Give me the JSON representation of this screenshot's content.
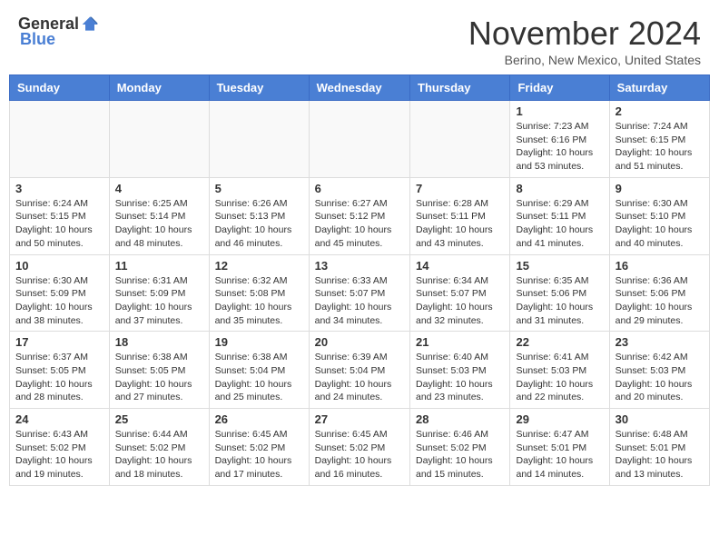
{
  "header": {
    "logo_general": "General",
    "logo_blue": "Blue",
    "month_title": "November 2024",
    "location": "Berino, New Mexico, United States"
  },
  "days_of_week": [
    "Sunday",
    "Monday",
    "Tuesday",
    "Wednesday",
    "Thursday",
    "Friday",
    "Saturday"
  ],
  "weeks": [
    [
      {
        "day": "",
        "info": ""
      },
      {
        "day": "",
        "info": ""
      },
      {
        "day": "",
        "info": ""
      },
      {
        "day": "",
        "info": ""
      },
      {
        "day": "",
        "info": ""
      },
      {
        "day": "1",
        "info": "Sunrise: 7:23 AM\nSunset: 6:16 PM\nDaylight: 10 hours and 53 minutes."
      },
      {
        "day": "2",
        "info": "Sunrise: 7:24 AM\nSunset: 6:15 PM\nDaylight: 10 hours and 51 minutes."
      }
    ],
    [
      {
        "day": "3",
        "info": "Sunrise: 6:24 AM\nSunset: 5:15 PM\nDaylight: 10 hours and 50 minutes."
      },
      {
        "day": "4",
        "info": "Sunrise: 6:25 AM\nSunset: 5:14 PM\nDaylight: 10 hours and 48 minutes."
      },
      {
        "day": "5",
        "info": "Sunrise: 6:26 AM\nSunset: 5:13 PM\nDaylight: 10 hours and 46 minutes."
      },
      {
        "day": "6",
        "info": "Sunrise: 6:27 AM\nSunset: 5:12 PM\nDaylight: 10 hours and 45 minutes."
      },
      {
        "day": "7",
        "info": "Sunrise: 6:28 AM\nSunset: 5:11 PM\nDaylight: 10 hours and 43 minutes."
      },
      {
        "day": "8",
        "info": "Sunrise: 6:29 AM\nSunset: 5:11 PM\nDaylight: 10 hours and 41 minutes."
      },
      {
        "day": "9",
        "info": "Sunrise: 6:30 AM\nSunset: 5:10 PM\nDaylight: 10 hours and 40 minutes."
      }
    ],
    [
      {
        "day": "10",
        "info": "Sunrise: 6:30 AM\nSunset: 5:09 PM\nDaylight: 10 hours and 38 minutes."
      },
      {
        "day": "11",
        "info": "Sunrise: 6:31 AM\nSunset: 5:09 PM\nDaylight: 10 hours and 37 minutes."
      },
      {
        "day": "12",
        "info": "Sunrise: 6:32 AM\nSunset: 5:08 PM\nDaylight: 10 hours and 35 minutes."
      },
      {
        "day": "13",
        "info": "Sunrise: 6:33 AM\nSunset: 5:07 PM\nDaylight: 10 hours and 34 minutes."
      },
      {
        "day": "14",
        "info": "Sunrise: 6:34 AM\nSunset: 5:07 PM\nDaylight: 10 hours and 32 minutes."
      },
      {
        "day": "15",
        "info": "Sunrise: 6:35 AM\nSunset: 5:06 PM\nDaylight: 10 hours and 31 minutes."
      },
      {
        "day": "16",
        "info": "Sunrise: 6:36 AM\nSunset: 5:06 PM\nDaylight: 10 hours and 29 minutes."
      }
    ],
    [
      {
        "day": "17",
        "info": "Sunrise: 6:37 AM\nSunset: 5:05 PM\nDaylight: 10 hours and 28 minutes."
      },
      {
        "day": "18",
        "info": "Sunrise: 6:38 AM\nSunset: 5:05 PM\nDaylight: 10 hours and 27 minutes."
      },
      {
        "day": "19",
        "info": "Sunrise: 6:38 AM\nSunset: 5:04 PM\nDaylight: 10 hours and 25 minutes."
      },
      {
        "day": "20",
        "info": "Sunrise: 6:39 AM\nSunset: 5:04 PM\nDaylight: 10 hours and 24 minutes."
      },
      {
        "day": "21",
        "info": "Sunrise: 6:40 AM\nSunset: 5:03 PM\nDaylight: 10 hours and 23 minutes."
      },
      {
        "day": "22",
        "info": "Sunrise: 6:41 AM\nSunset: 5:03 PM\nDaylight: 10 hours and 22 minutes."
      },
      {
        "day": "23",
        "info": "Sunrise: 6:42 AM\nSunset: 5:03 PM\nDaylight: 10 hours and 20 minutes."
      }
    ],
    [
      {
        "day": "24",
        "info": "Sunrise: 6:43 AM\nSunset: 5:02 PM\nDaylight: 10 hours and 19 minutes."
      },
      {
        "day": "25",
        "info": "Sunrise: 6:44 AM\nSunset: 5:02 PM\nDaylight: 10 hours and 18 minutes."
      },
      {
        "day": "26",
        "info": "Sunrise: 6:45 AM\nSunset: 5:02 PM\nDaylight: 10 hours and 17 minutes."
      },
      {
        "day": "27",
        "info": "Sunrise: 6:45 AM\nSunset: 5:02 PM\nDaylight: 10 hours and 16 minutes."
      },
      {
        "day": "28",
        "info": "Sunrise: 6:46 AM\nSunset: 5:02 PM\nDaylight: 10 hours and 15 minutes."
      },
      {
        "day": "29",
        "info": "Sunrise: 6:47 AM\nSunset: 5:01 PM\nDaylight: 10 hours and 14 minutes."
      },
      {
        "day": "30",
        "info": "Sunrise: 6:48 AM\nSunset: 5:01 PM\nDaylight: 10 hours and 13 minutes."
      }
    ]
  ]
}
